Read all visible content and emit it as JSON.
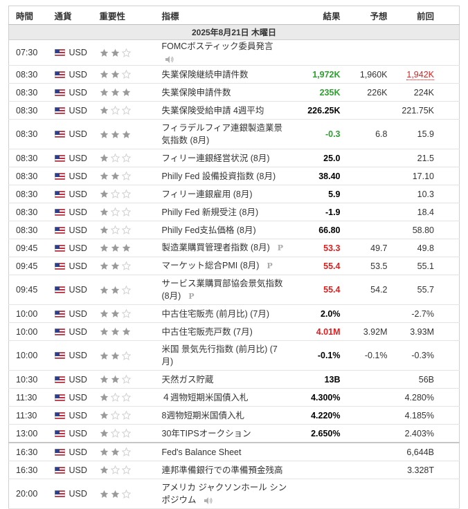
{
  "headers": {
    "time": "時間",
    "currency": "通貨",
    "importance": "重要性",
    "event": "指標",
    "actual": "結果",
    "forecast": "予想",
    "previous": "前回"
  },
  "date_label": "2025年8月21日 木曜日",
  "colors": {
    "green": "#2ca02c",
    "red": "#e01e1e",
    "star_on": "#9a9a9a",
    "star_off": "#d0d0d0"
  },
  "rows": [
    {
      "time": "07:30",
      "currency": "USD",
      "stars": 2,
      "event": "FOMCボスティック委員発言",
      "icon": "speaker-icon",
      "actual": "",
      "actual_color": "",
      "forecast": "",
      "previous": "",
      "previous_style": ""
    },
    {
      "time": "08:30",
      "currency": "USD",
      "stars": 2,
      "event": "失業保険継続申請件数",
      "actual": "1,972K",
      "actual_color": "green",
      "forecast": "1,960K",
      "previous": "1,942K",
      "previous_style": "revised"
    },
    {
      "time": "08:30",
      "currency": "USD",
      "stars": 3,
      "event": "失業保険申請件数",
      "actual": "235K",
      "actual_color": "green",
      "forecast": "226K",
      "previous": "224K",
      "previous_style": ""
    },
    {
      "time": "08:30",
      "currency": "USD",
      "stars": 1,
      "event": "失業保険受給申請 4週平均",
      "actual": "226.25K",
      "actual_color": "black",
      "forecast": "",
      "previous": "221.75K",
      "previous_style": ""
    },
    {
      "time": "08:30",
      "currency": "USD",
      "stars": 3,
      "event": "フィラデルフィア連銀製造業景気指数 (8月)",
      "actual": "-0.3",
      "actual_color": "green",
      "forecast": "6.8",
      "previous": "15.9",
      "previous_style": "",
      "tall": true
    },
    {
      "time": "08:30",
      "currency": "USD",
      "stars": 1,
      "event": "フィリー連銀経営状況 (8月)",
      "actual": "25.0",
      "actual_color": "black",
      "forecast": "",
      "previous": "21.5",
      "previous_style": ""
    },
    {
      "time": "08:30",
      "currency": "USD",
      "stars": 2,
      "event": "Philly Fed 設備投資指数 (8月)",
      "actual": "38.40",
      "actual_color": "black",
      "forecast": "",
      "previous": "17.10",
      "previous_style": ""
    },
    {
      "time": "08:30",
      "currency": "USD",
      "stars": 1,
      "event": "フィリー連銀雇用 (8月)",
      "actual": "5.9",
      "actual_color": "black",
      "forecast": "",
      "previous": "10.3",
      "previous_style": ""
    },
    {
      "time": "08:30",
      "currency": "USD",
      "stars": 1,
      "event": "Philly Fed 新規受注 (8月)",
      "actual": "-1.9",
      "actual_color": "black",
      "forecast": "",
      "previous": "18.4",
      "previous_style": ""
    },
    {
      "time": "08:30",
      "currency": "USD",
      "stars": 1,
      "event": "Philly Fed支払価格 (8月)",
      "actual": "66.80",
      "actual_color": "black",
      "forecast": "",
      "previous": "58.80",
      "previous_style": ""
    },
    {
      "time": "09:45",
      "currency": "USD",
      "stars": 3,
      "event": "製造業購買管理者指数 (8月)",
      "icon": "p-icon",
      "actual": "53.3",
      "actual_color": "red",
      "forecast": "49.7",
      "previous": "49.8",
      "previous_style": ""
    },
    {
      "time": "09:45",
      "currency": "USD",
      "stars": 2,
      "event": "マーケット総合PMI (8月)",
      "icon": "p-icon",
      "actual": "55.4",
      "actual_color": "red",
      "forecast": "53.5",
      "previous": "55.1",
      "previous_style": ""
    },
    {
      "time": "09:45",
      "currency": "USD",
      "stars": 2,
      "event": "サービス業購買部協会景気指数 (8月)",
      "icon": "p-icon",
      "actual": "55.4",
      "actual_color": "red",
      "forecast": "54.2",
      "previous": "55.7",
      "previous_style": "",
      "tall": true
    },
    {
      "time": "10:00",
      "currency": "USD",
      "stars": 2,
      "event": "中古住宅販売 (前月比) (7月)",
      "actual": "2.0%",
      "actual_color": "black",
      "forecast": "",
      "previous": "-2.7%",
      "previous_style": ""
    },
    {
      "time": "10:00",
      "currency": "USD",
      "stars": 3,
      "event": "中古住宅販売戸数 (7月)",
      "actual": "4.01M",
      "actual_color": "red",
      "forecast": "3.92M",
      "previous": "3.93M",
      "previous_style": ""
    },
    {
      "time": "10:00",
      "currency": "USD",
      "stars": 2,
      "event": "米国 景気先行指数 (前月比) (7月)",
      "actual": "-0.1%",
      "actual_color": "black",
      "forecast": "-0.1%",
      "previous": "-0.3%",
      "previous_style": "",
      "tall": true
    },
    {
      "time": "10:30",
      "currency": "USD",
      "stars": 2,
      "event": "天然ガス貯蔵",
      "actual": "13B",
      "actual_color": "black",
      "forecast": "",
      "previous": "56B",
      "previous_style": ""
    },
    {
      "time": "11:30",
      "currency": "USD",
      "stars": 1,
      "event": "４週物短期米国債入札",
      "actual": "4.300%",
      "actual_color": "black",
      "forecast": "",
      "previous": "4.280%",
      "previous_style": ""
    },
    {
      "time": "11:30",
      "currency": "USD",
      "stars": 1,
      "event": "8週物短期米国債入札",
      "actual": "4.220%",
      "actual_color": "black",
      "forecast": "",
      "previous": "4.185%",
      "previous_style": ""
    },
    {
      "time": "13:00",
      "currency": "USD",
      "stars": 1,
      "event": "30年TIPSオークション",
      "actual": "2.650%",
      "actual_color": "black",
      "forecast": "",
      "previous": "2.403%",
      "previous_style": ""
    },
    {
      "time": "16:30",
      "currency": "USD",
      "stars": 2,
      "event": "Fed's Balance Sheet",
      "actual": "",
      "actual_color": "",
      "forecast": "",
      "previous": "6,644B",
      "previous_style": "",
      "sep": true
    },
    {
      "time": "16:30",
      "currency": "USD",
      "stars": 1,
      "event": "連邦準備銀行での準備預金残高",
      "actual": "",
      "actual_color": "",
      "forecast": "",
      "previous": "3.328T",
      "previous_style": ""
    },
    {
      "time": "20:00",
      "currency": "USD",
      "stars": 2,
      "event": "アメリカ ジャクソンホール シンポジウム",
      "icon": "speaker-icon",
      "actual": "",
      "actual_color": "",
      "forecast": "",
      "previous": "",
      "previous_style": "",
      "tall": true
    }
  ]
}
